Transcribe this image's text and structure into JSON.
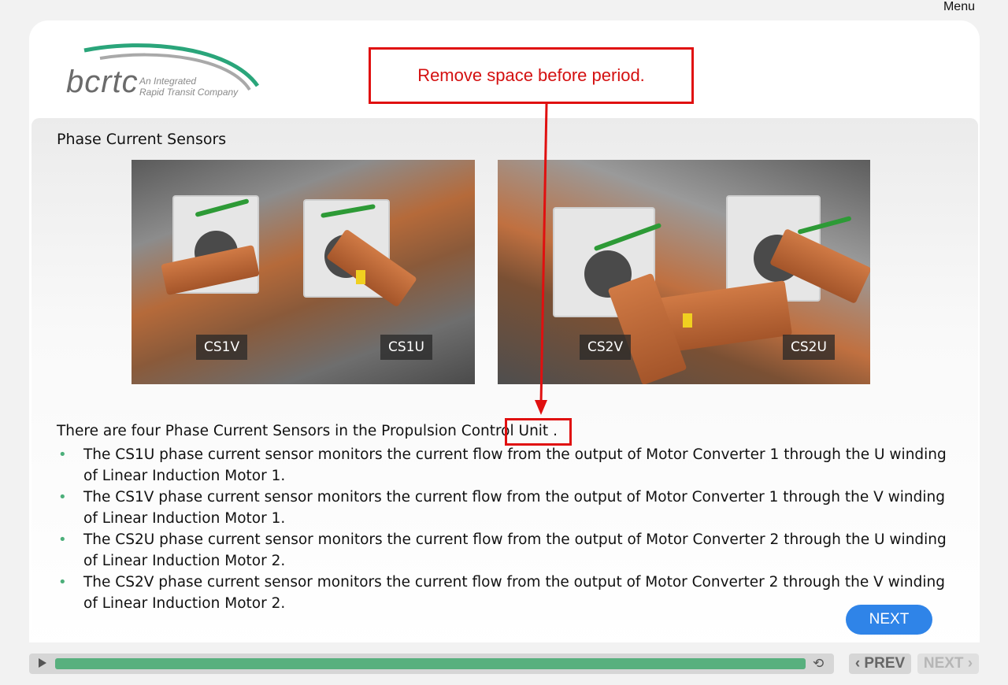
{
  "header": {
    "menu_label": "Menu",
    "logo_text": "bcrtc",
    "logo_tagline_1": "An Integrated",
    "logo_tagline_2": "Rapid Transit Company"
  },
  "slide": {
    "title": "Phase Current Sensors",
    "photos": [
      {
        "labels": [
          "CS1V",
          "CS1U"
        ]
      },
      {
        "labels": [
          "CS2V",
          "CS2U"
        ]
      }
    ],
    "intro": "There are four Phase Current Sensors in the Propulsion Control Unit .",
    "bullets": [
      {
        "line": "The CS1U phase current sensor monitors the current flow from the output of Motor Converter 1 through the U winding of Linear Induction Motor 1."
      },
      {
        "line": "The CS1V phase current sensor monitors the current flow from the output of Motor Converter 1 through the V winding of Linear Induction Motor 1."
      },
      {
        "line": "The CS2U phase current sensor monitors the current flow from the output of Motor Converter 2 through the U winding of Linear Induction Motor 2."
      },
      {
        "line": "The CS2V phase current sensor monitors the current flow from the output of Motor Converter 2 through the V winding of Linear Induction Motor 2."
      }
    ],
    "next_button": "NEXT"
  },
  "annotation": {
    "callout_text": "Remove space before period.",
    "color": "#e01010"
  },
  "player": {
    "progress_fraction": 1.0,
    "prev_label": "‹ PREV",
    "next_label": "NEXT ›",
    "play_icon": "play-icon",
    "replay_icon": "replay-icon"
  },
  "colors": {
    "accent_blue": "#2f84e8",
    "bullet_green": "#4caf7a",
    "progress_green": "#58b07e"
  }
}
